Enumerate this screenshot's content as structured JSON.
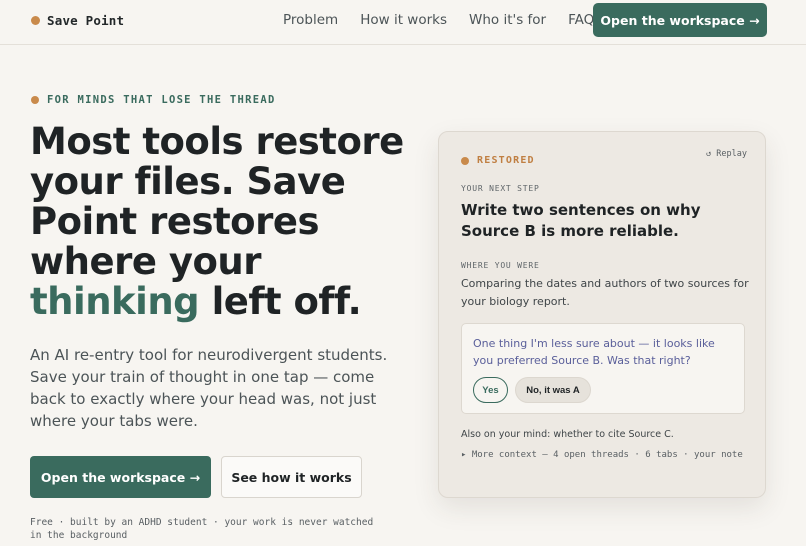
{
  "brand": {
    "name": "Save Point",
    "dot_color": "#c98a4b"
  },
  "nav": {
    "links": [
      "Problem",
      "How it works",
      "Who it's for",
      "FAQ"
    ],
    "cta": "Open the workspace →"
  },
  "hero": {
    "eyebrow": "FOR MINDS THAT LOSE THE THREAD",
    "headline_part1": "Most tools restore your files. Save Point restores where your",
    "headline_accent": "thinking",
    "headline_part2": "left off.",
    "subtitle": "An AI re-entry tool for neurodivergent students. Save your train of thought in one tap — come back to exactly where your head was, not just where your tabs were.",
    "primary_button": "Open the workspace →",
    "secondary_button": "See how it works",
    "footnote": "Free · built by an ADHD student · your work is never watched in the background"
  },
  "card": {
    "status": "RESTORED",
    "replay": "↺ Replay",
    "next_step_label": "YOUR NEXT STEP",
    "next_step": "Write two sentences on why Source B is more reliable.",
    "where_label": "WHERE YOU WERE",
    "where_text": "Comparing the dates and authors of two sources for your biology report.",
    "question": "One thing I'm less sure about — it looks like you preferred Source B. Was that right?",
    "yes_label": "Yes",
    "no_label": "No, it was A",
    "also_on_mind": "Also on your mind: whether to cite Source C.",
    "more_context": "▸ More context — 4 open threads · 6 tabs · your note"
  },
  "colors": {
    "accent": "#3a6b5e",
    "orange": "#c98a4b",
    "background": "#f7f5f1",
    "question_text": "#5a5f9a"
  }
}
